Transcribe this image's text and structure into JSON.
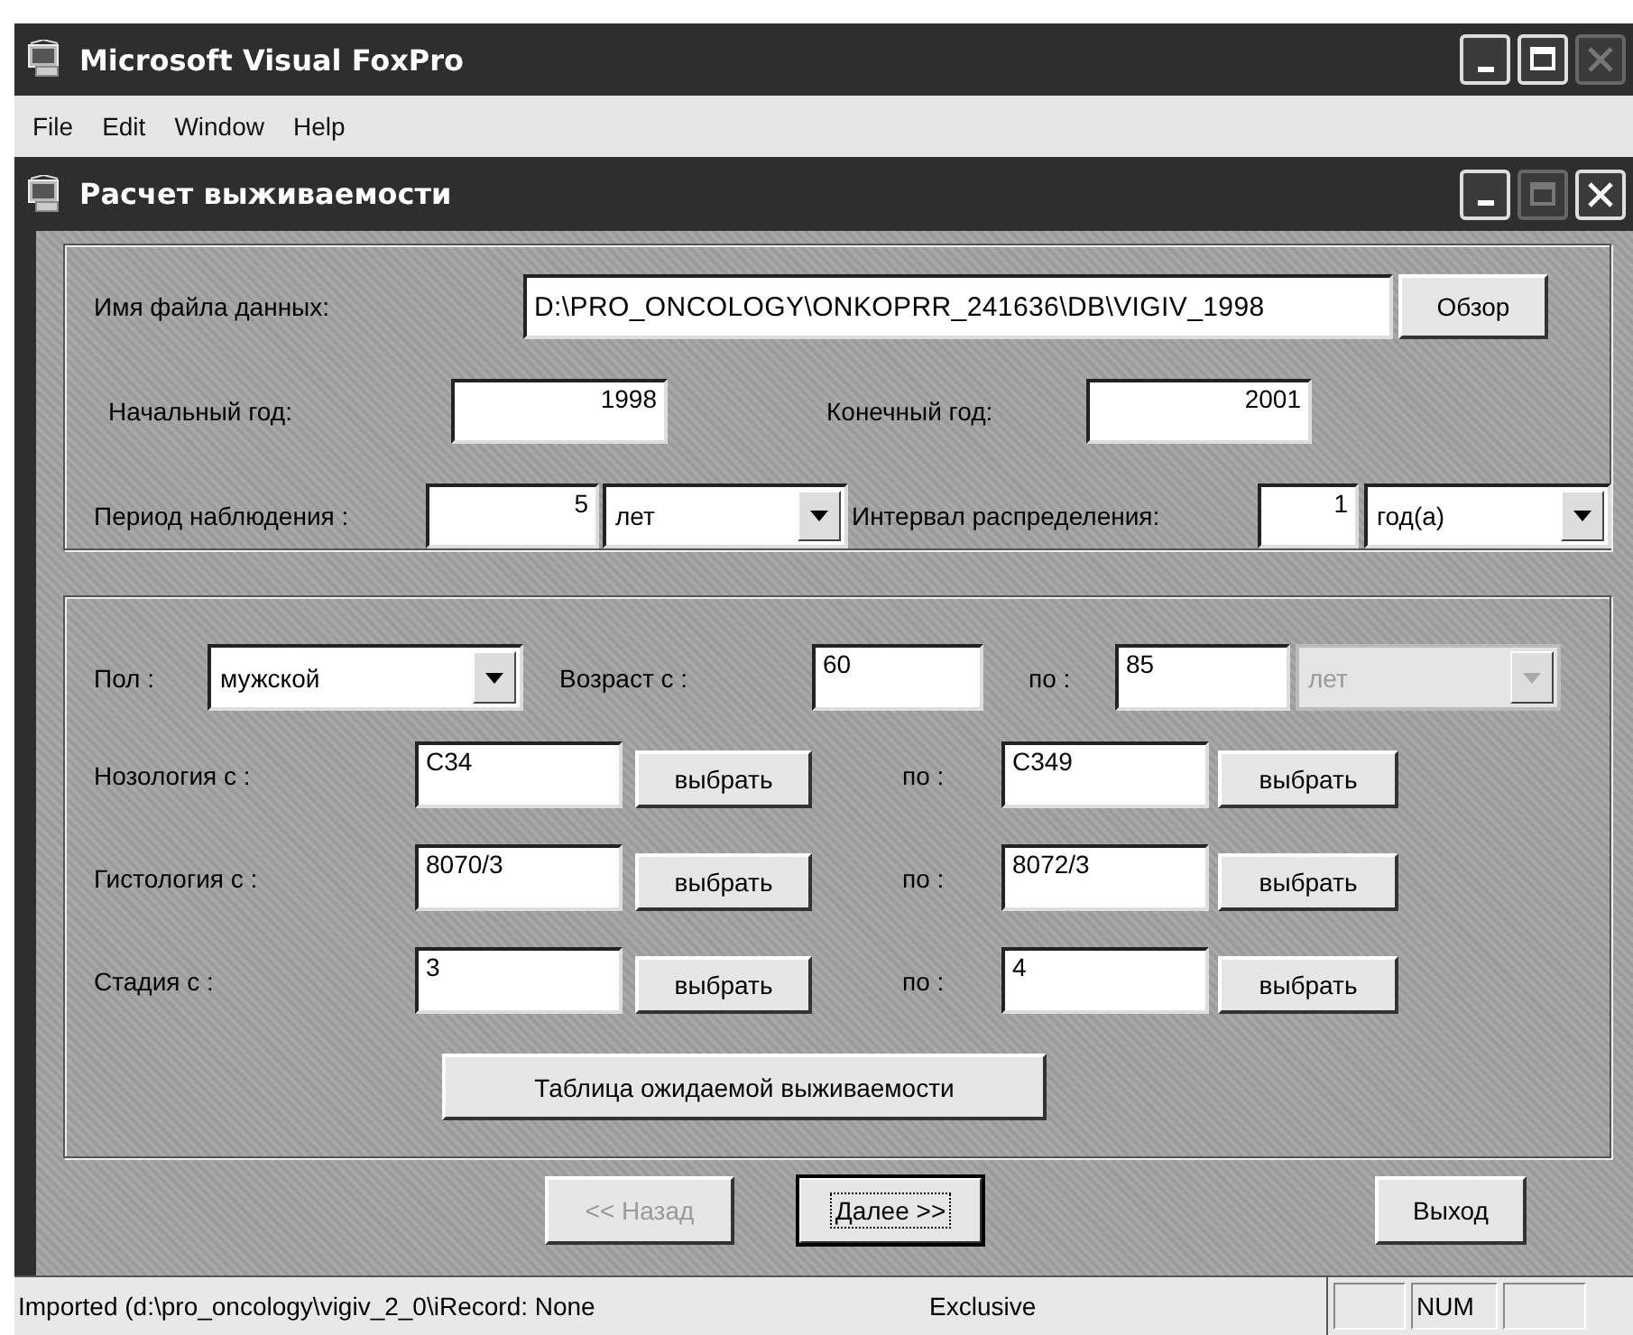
{
  "app_window": {
    "title": "Microsoft Visual FoxPro",
    "close_disabled": true
  },
  "menu": [
    "File",
    "Edit",
    "Window",
    "Help"
  ],
  "form": {
    "title": "Расчет выживаемости",
    "maximize_disabled": true,
    "data_file": {
      "label": "Имя файла данных:",
      "value": "D:\\PRO_ONCOLOGY\\ONKOPRR_241636\\DB\\VIGIV_1998",
      "button": "Обзор"
    },
    "start_year": {
      "label": "Начальный год:",
      "value": "1998"
    },
    "end_year": {
      "label": "Конечный год:",
      "value": "2001"
    },
    "period": {
      "label": "Период наблюдения :",
      "value": "5",
      "unit": "лет"
    },
    "interval": {
      "label": "Интервал распределения:",
      "value": "1",
      "unit": "год(а)"
    },
    "sex": {
      "label": "Пол :",
      "value": "мужской"
    },
    "age": {
      "label_from": "Возраст с :",
      "from": "60",
      "label_to": "по :",
      "to": "85",
      "unit": "лет",
      "unit_disabled": true
    },
    "ranges": [
      {
        "label": "Нозология с :",
        "from": "C34",
        "from_button": "выбрать",
        "label_to": "по :",
        "to": "C349",
        "to_button": "выбрать"
      },
      {
        "label": "Гистология с :",
        "from": "8070/3",
        "from_button": "выбрать",
        "label_to": "по :",
        "to": "8072/3",
        "to_button": "выбрать"
      },
      {
        "label": "Стадия с :",
        "from": "3",
        "from_button": "выбрать",
        "label_to": "по :",
        "to": "4",
        "to_button": "выбрать"
      }
    ],
    "table_button": "Таблица ожидаемой выживаемости",
    "nav_buttons": [
      {
        "label": "<< Назад",
        "disabled": true,
        "default": false
      },
      {
        "label": "Далее >>",
        "disabled": false,
        "default": true
      },
      {
        "label": "Выход",
        "disabled": false,
        "default": false
      }
    ]
  },
  "status_bar": {
    "message": "Imported (d:\\pro_oncology\\vigiv_2_0\\iRecord: None",
    "mode": "Exclusive",
    "num_indicator": "NUM"
  }
}
